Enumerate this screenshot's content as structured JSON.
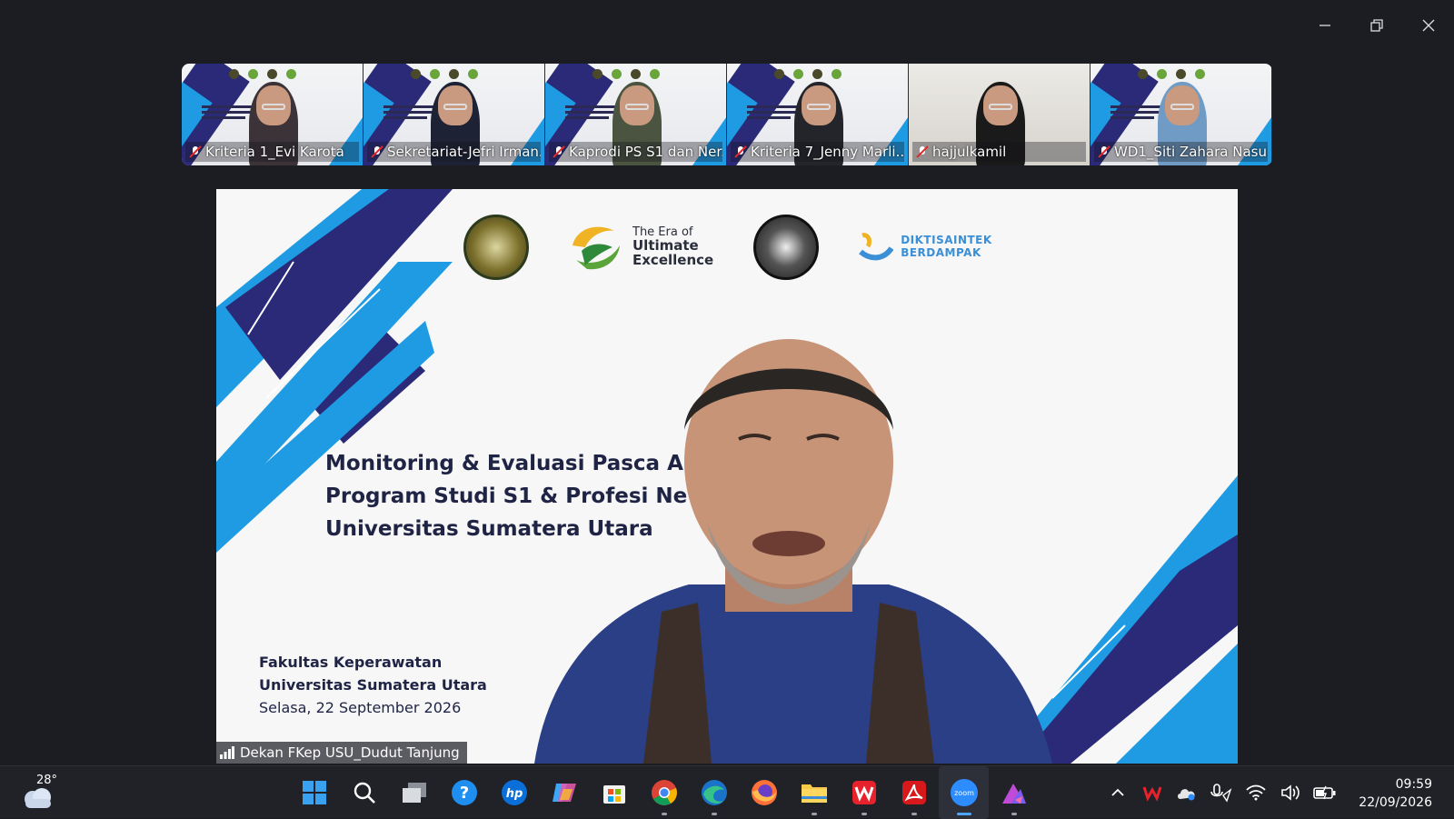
{
  "window": {
    "controls": [
      "minimize",
      "restore",
      "close"
    ]
  },
  "participants": [
    {
      "name": "Kriteria 1_Evi Karota",
      "hijab": "#3b3338"
    },
    {
      "name": "Sekretariat-Jefri Irman...",
      "hijab": "#1d2235"
    },
    {
      "name": "Kaprodi PS S1 dan Ner...",
      "hijab": "#4a5440"
    },
    {
      "name": "Kriteria 7_Jenny Marli...",
      "hijab": "#23252a"
    },
    {
      "name": "hajjulkamil",
      "hijab": "#1a1a1a"
    },
    {
      "name": "WD1_Siti Zahara Nasu...",
      "hijab": "#6f9bc4"
    }
  ],
  "slide": {
    "era_line1": "The Era of",
    "era_line2": "Ultimate",
    "era_line3": "Excellence",
    "dikti_line1": "DIKTISAINTEK",
    "dikti_line2": "BERDAMPAK",
    "title_line1": "Monitoring & Evaluasi Pasca A",
    "title_line2": "Program Studi S1 & Profesi Ne",
    "title_line3": "Universitas Sumatera Utara",
    "faculty": "Fakultas Keperawatan",
    "university": "Universitas Sumatera Utara",
    "date": "Selasa, 22 September 2026"
  },
  "active_speaker": {
    "caption": "Dekan FKep USU_Dudut Tanjung"
  },
  "taskbar": {
    "temperature": "28°",
    "apps": [
      "start-icon",
      "search-icon",
      "task-view-icon",
      "help-icon",
      "hp-icon",
      "copilot-icon",
      "store-icon",
      "chrome-icon",
      "edge-icon",
      "firefox-icon",
      "file-explorer-icon",
      "wps-icon",
      "acrobat-icon",
      "zoom-icon",
      "affinity-icon"
    ],
    "time": "09:59",
    "date": "22/09/2026"
  },
  "colors": {
    "navy": "#2a2a78",
    "sky": "#1e9be3",
    "title_text": "#1f2445",
    "taskbar": "#202227"
  }
}
